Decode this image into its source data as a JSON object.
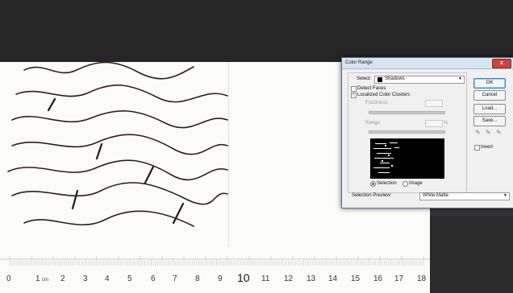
{
  "dialog": {
    "title": "Color Range",
    "close_label": "x",
    "select_label": "Select:",
    "select_value": "Shadows",
    "detect_faces": "Detect Faces",
    "localized": "Localized Color Clusters",
    "fuzziness": "Fuzziness:",
    "range": "Range:",
    "range_unit": "%",
    "radio_selection": "Selection",
    "radio_image": "Image",
    "buttons": {
      "ok": "OK",
      "cancel": "Cancel",
      "load": "Load...",
      "save": "Save..."
    },
    "invert": "Invert",
    "preview_label": "Selection Preview:",
    "preview_value": "White Matte"
  },
  "ruler": {
    "labels": [
      "0",
      "1",
      "cm",
      "2",
      "3",
      "4",
      "5",
      "6",
      "7",
      "8",
      "9",
      "10",
      "11",
      "12",
      "13",
      "14",
      "15",
      "16",
      "17",
      "18"
    ]
  },
  "colors": {
    "workspace": "#262626",
    "paper": "#fbfbf9",
    "ink": "#2b2117",
    "dialog_bg": "#f0f0f0",
    "ok_border": "#3c7fb1"
  }
}
